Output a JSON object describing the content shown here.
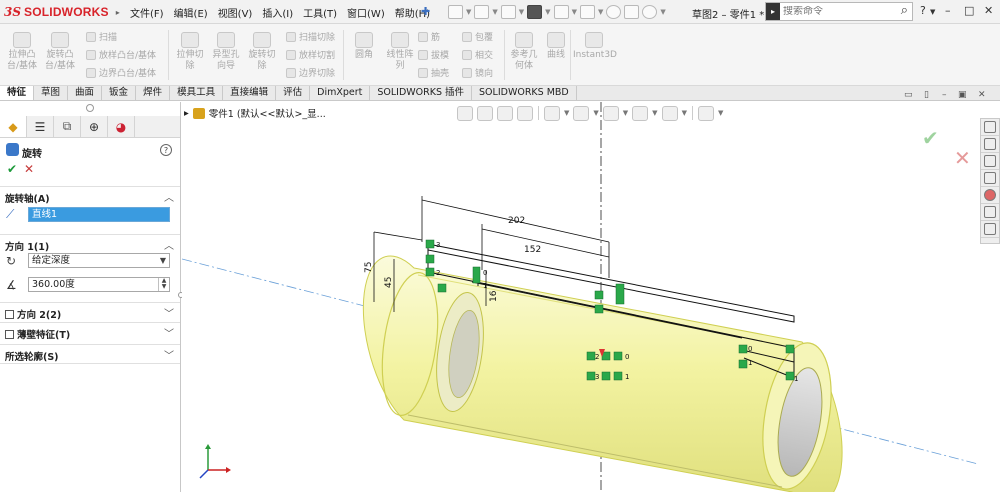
{
  "title_bar": {
    "logo_ds": "3S",
    "logo_text": "SOLIDWORKS",
    "menus": [
      "文件(F)",
      "编辑(E)",
      "视图(V)",
      "插入(I)",
      "工具(T)",
      "窗口(W)",
      "帮助(H)"
    ],
    "document_title": "草图2 – 零件1 *",
    "search_placeholder": "搜索命令",
    "help_symbol": "?",
    "window_buttons": [
      "–",
      "□",
      "✕"
    ]
  },
  "command_manager": {
    "large": [
      {
        "label": "拉伸凸\n台/基体"
      },
      {
        "label": "旋转凸\n台/基体"
      },
      {
        "label": "拉伸切\n除"
      },
      {
        "label": "异型孔\n向导"
      },
      {
        "label": "旋转切\n除"
      },
      {
        "label": "圆角"
      },
      {
        "label": "线性阵\n列"
      },
      {
        "label": "参考几\n何体"
      },
      {
        "label": "曲线"
      },
      {
        "label": "Instant3D"
      }
    ],
    "small": [
      {
        "label": "扫描"
      },
      {
        "label": "放样凸台/基体"
      },
      {
        "label": "边界凸台/基体"
      },
      {
        "label": "扫描切除"
      },
      {
        "label": "放样切割"
      },
      {
        "label": "边界切除"
      },
      {
        "label": "筋"
      },
      {
        "label": "拔模"
      },
      {
        "label": "抽壳"
      },
      {
        "label": "包覆"
      },
      {
        "label": "相交"
      },
      {
        "label": "镜向"
      }
    ]
  },
  "tabs": [
    "特征",
    "草图",
    "曲面",
    "钣金",
    "焊件",
    "模具工具",
    "直接编辑",
    "评估",
    "DimXpert",
    "SOLIDWORKS 插件",
    "SOLIDWORKS MBD"
  ],
  "active_tab": "特征",
  "property_manager": {
    "feature_title": "旋转",
    "help": "?",
    "ok_symbol": "✔",
    "cancel_symbol": "✕",
    "axis_section": "旋转轴(A)",
    "axis_value": "直线1",
    "direction1_section": "方向 1(1)",
    "end_condition": "给定深度",
    "angle": "360.00度",
    "direction2_section": "方向 2(2)",
    "thin_section": "薄壁特征(T)",
    "contours_section": "所选轮廓(S)"
  },
  "feature_tree": {
    "arrow": "▸",
    "label": "零件1  (默认<<默认>_显..."
  },
  "sketch_dimensions": [
    "202",
    "152",
    "75",
    "45",
    "16"
  ],
  "relation_labels": [
    "3",
    "2",
    "1",
    "0",
    "1",
    "2",
    "3",
    "0",
    "1",
    "0",
    "1"
  ],
  "colors": {
    "accent_blue": "#3a9be0",
    "model_yellow": "#f0f07a",
    "model_edge": "#d6d63a",
    "relation_green": "#2aa84a",
    "ok_green": "#1c9a3a",
    "cancel_red": "#c63a3a",
    "brand_red": "#d8232a"
  }
}
